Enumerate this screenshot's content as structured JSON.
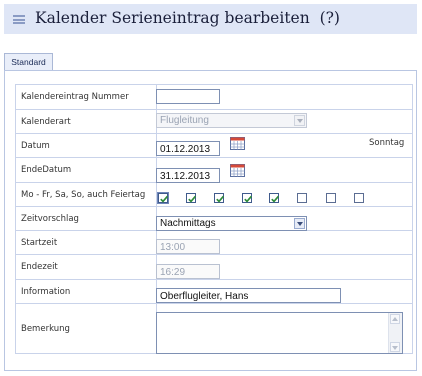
{
  "window": {
    "title": "Kalender Serieneintrag bearbeiten",
    "help": "(?)"
  },
  "tabs": [
    {
      "label": "Standard",
      "active": true
    }
  ],
  "form": {
    "kalendereintrag_nummer": {
      "label": "Kalendereintrag Nummer",
      "value": ""
    },
    "kalenderart": {
      "label": "Kalenderart",
      "value": "Flugleitung",
      "disabled": true
    },
    "datum": {
      "label": "Datum",
      "value": "01.12.2013",
      "weekday": "Sonntag"
    },
    "endedatum": {
      "label": "EndeDatum",
      "value": "31.12.2013"
    },
    "wochentage": {
      "label": "Mo - Fr, Sa, So, auch Feiertag",
      "checked": [
        true,
        true,
        true,
        true,
        true,
        false,
        false,
        false
      ]
    },
    "zeitvorschlag": {
      "label": "Zeitvorschlag",
      "value": "Nachmittags"
    },
    "startzeit": {
      "label": "Startzeit",
      "value": "13:00",
      "disabled": true
    },
    "endezeit": {
      "label": "Endezeit",
      "value": "16:29",
      "disabled": true
    },
    "information": {
      "label": "Information",
      "value": "Oberflugleiter, Hans"
    },
    "bemerkung": {
      "label": "Bemerkung",
      "value": ""
    }
  },
  "icons": {
    "menu": "hamburger-icon",
    "calendar": "calendar-icon",
    "dropdown": "chevron-down-icon"
  },
  "colors": {
    "titlebar_bg": "#dfe6f6",
    "border": "#c9d3ea",
    "check": "#2e8b3a"
  }
}
